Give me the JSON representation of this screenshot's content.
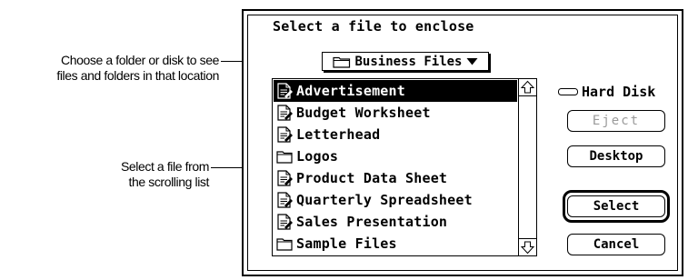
{
  "callouts": {
    "folder": [
      "Choose a folder or disk to see",
      "files and folders in that location"
    ],
    "list": [
      "Select a file from",
      "the scrolling list"
    ]
  },
  "dialog": {
    "title": "Select a file to enclose",
    "popup_label": "Business Files",
    "popup_icon": "folder-icon",
    "disk_name": "Hard Disk",
    "disk_icon": "hard-disk-icon",
    "buttons": {
      "eject": "Eject",
      "desktop": "Desktop",
      "select": "Select",
      "cancel": "Cancel"
    },
    "files": [
      {
        "name": "Advertisement",
        "icon": "document-icon",
        "selected": true
      },
      {
        "name": "Budget Worksheet",
        "icon": "document-icon",
        "selected": false
      },
      {
        "name": "Letterhead",
        "icon": "document-icon",
        "selected": false
      },
      {
        "name": "Logos",
        "icon": "folder-icon",
        "selected": false
      },
      {
        "name": "Product Data Sheet",
        "icon": "document-icon",
        "selected": false
      },
      {
        "name": "Quarterly Spreadsheet",
        "icon": "document-icon",
        "selected": false
      },
      {
        "name": "Sales Presentation",
        "icon": "document-icon",
        "selected": false
      },
      {
        "name": "Sample Files",
        "icon": "folder-icon",
        "selected": false
      }
    ]
  }
}
